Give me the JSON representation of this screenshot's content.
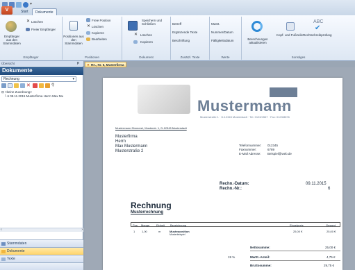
{
  "ribbon": {
    "tabs": [
      "Start",
      "Dokumente"
    ],
    "groups": {
      "empfaenger": {
        "label": "Empfänger",
        "big_button": "Empfänger aus den Stammdaten",
        "loeschen": "Löschen",
        "freier": "Freier Empfänger"
      },
      "positionen": {
        "label": "Positionen",
        "big_button": "Positionen aus den Stammdaten",
        "freie": "Freie Position",
        "loeschen": "Löschen",
        "kopieren": "Kopieren",
        "bearbeiten": "Bearbeiten"
      },
      "dokument": {
        "label": "Dokument",
        "big_button": "Speichern und Schließen",
        "loeschen": "Löschen",
        "kopieren": "Kopieren"
      },
      "zusaetzl": {
        "label": "Zusätzl. Texte",
        "betreff": "Betreff",
        "ergaenzende": "Ergänzende Texte",
        "beschriftung": "Beschriftung"
      },
      "werte": {
        "label": "Werte",
        "mwst": "MwSt.",
        "nummer": "Nummer/Datum",
        "faellig": "Fälligkeitsdatum"
      },
      "sonstiges": {
        "label": "Sonstiges",
        "berechnungen": "Berechnungen aktualisieren",
        "kopf": "Kopf- und Fußzeile",
        "recht": "Rechtschreibprüfung",
        "abc": "ABC"
      }
    }
  },
  "left": {
    "panel_header": "Übersicht",
    "title": "Dokumente",
    "select_value": "Rechnung",
    "tree": [
      "<keine Zuordnung>",
      "6  09.11.2015  Musterfirma Herrn Max Mu"
    ],
    "nav": [
      "Stammdaten",
      "Dokumente",
      "Texte"
    ]
  },
  "doc_tab": "Re., Nr. 6, Musterfirma",
  "document": {
    "logo": "Mustermann",
    "logo_dots": "...",
    "logo_sub": "Musterstraße 1 · D-12345 Musterstadt · Tel. 0123/4567 · Fax: 0123/8876",
    "sender_line": "Mustermann Zimmerei, Musterstr. 1, D-12345 Musterstadt",
    "recipient": [
      "Musterfirma",
      "Herrn",
      "Max Mustermann",
      "Musterstraße 2"
    ],
    "contact_labels": [
      "Telefonnummer:",
      "Faxnummer:",
      "E-Mail Adresse:"
    ],
    "contact_values": [
      "012345",
      "6789",
      "Beispiel@web.de"
    ],
    "date_label": "Rechn.-Datum:",
    "date_value": "09.11.2015",
    "nr_label": "Rechn.-Nr.:",
    "nr_value": "6",
    "heading": "Rechnung",
    "subheading": "Musterrechnung",
    "table_headers": [
      "Pos.",
      "Menge",
      "Einheit",
      "Bezeichnung",
      "Einzelpreis",
      "Gesamt"
    ],
    "row": {
      "pos": "1",
      "menge": "1,00",
      "einheit": "m",
      "bez1": "Musterposition",
      "bez2": "Musterbeispiel",
      "einzel": "25,00 €",
      "gesamt": "25,00 €"
    },
    "netto_label": "Nettosumme:",
    "netto_value": "25,00 €",
    "mwst_rate": "19 %",
    "mwst_label": "MwSt.-Anteil:",
    "mwst_value": "4,75 €",
    "brutto_label": "Bruttosumme:",
    "brutto_value": "29,75 €"
  }
}
